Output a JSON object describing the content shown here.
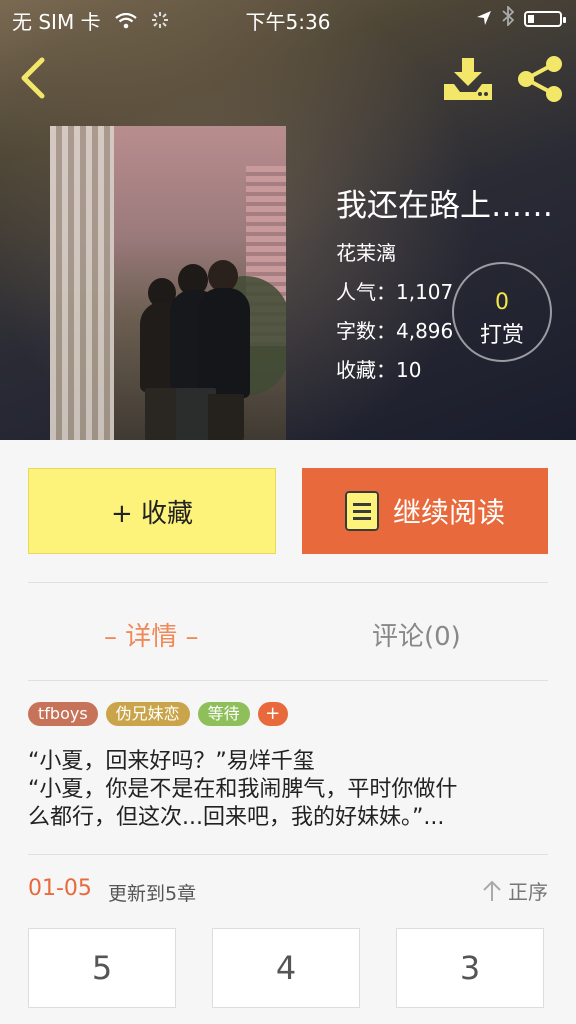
{
  "status_bar": {
    "carrier": "无 SIM 卡",
    "time": "下午5:36"
  },
  "book": {
    "title": "我还在路上……",
    "author": "花茉漓",
    "popularity": "人气：1,107",
    "word_count": "字数：4,896",
    "favorites": "收藏：10"
  },
  "reward": {
    "count": "0",
    "label": "打赏"
  },
  "actions": {
    "favorite_label": "+ 收藏",
    "continue_label": "继续阅读"
  },
  "tabs": {
    "detail": "– 详情 –",
    "comments": "评论(0)"
  },
  "tags": [
    {
      "label": "tfboys",
      "color": "#c7735a"
    },
    {
      "label": "伪兄妹恋",
      "color": "#c9a44a"
    },
    {
      "label": "等待",
      "color": "#8fbf5a"
    }
  ],
  "tag_add_label": "+",
  "intro": {
    "line1": "“小夏，回来好吗？”易烊千玺",
    "line2": "“小夏，你是不是在和我闹脾气，平时你做什",
    "line3": "么都行，但这次...回来吧，我的好妹妹。”..."
  },
  "update": {
    "date": "01-05",
    "text": "更新到5章",
    "sort_label": "正序"
  },
  "chapters": [
    "5",
    "4",
    "3"
  ],
  "colors": {
    "accent_orange": "#e86a3c",
    "accent_yellow": "#fdf27a"
  }
}
